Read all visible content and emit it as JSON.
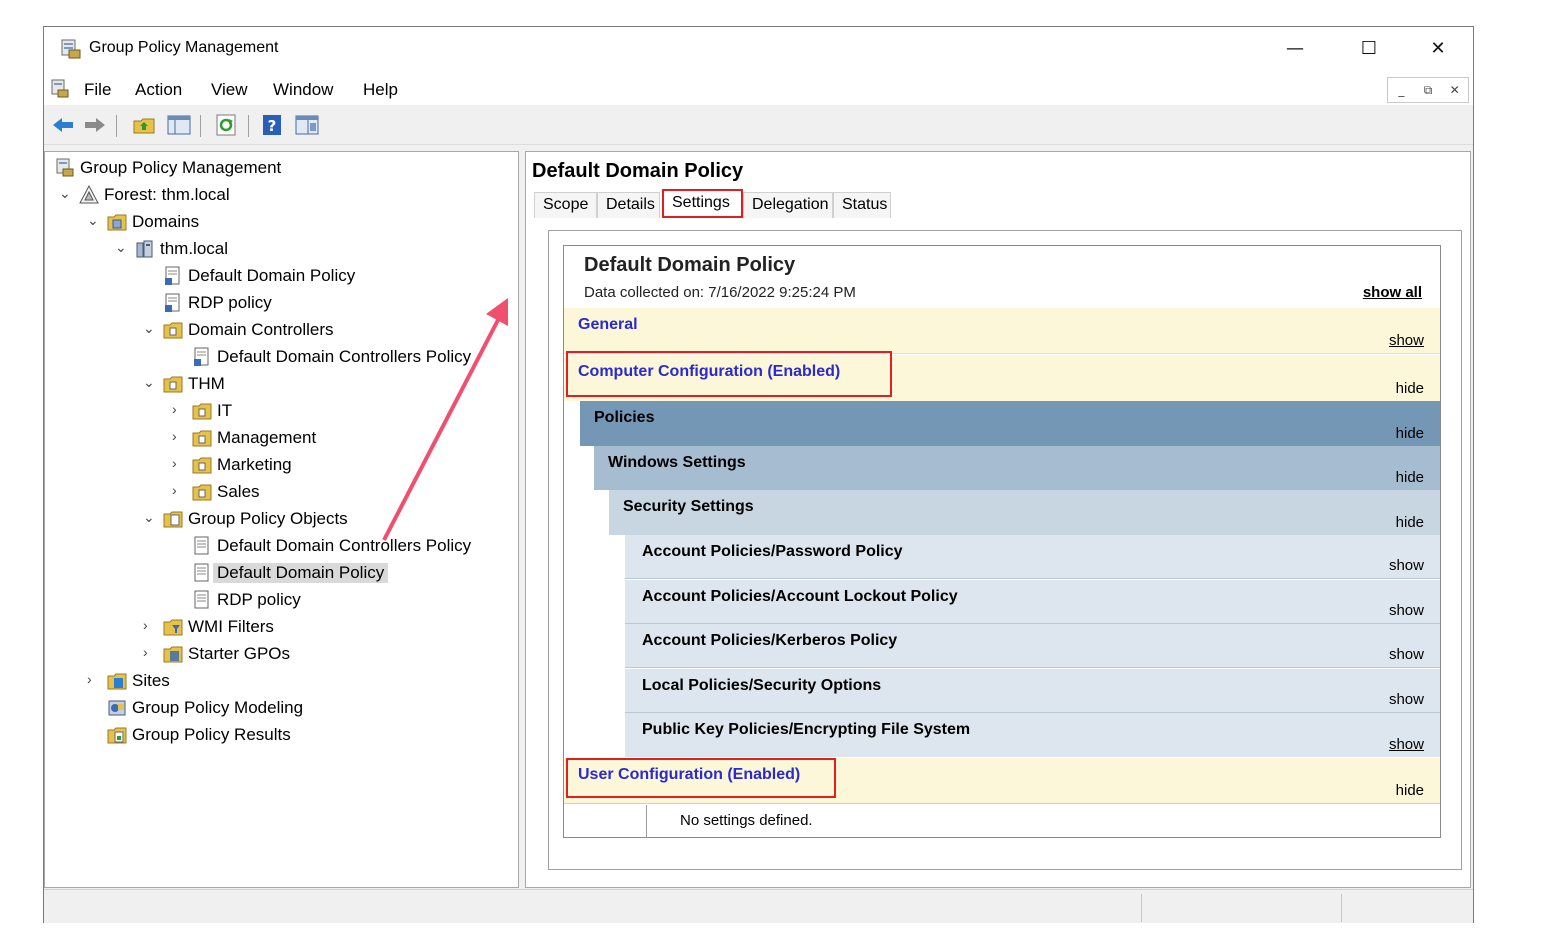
{
  "window": {
    "title": "Group Policy Management",
    "controls": {
      "minimize": "—",
      "maximize": "☐",
      "close": "✕"
    }
  },
  "menu": {
    "items": [
      "File",
      "Action",
      "View",
      "Window",
      "Help"
    ],
    "mdi": {
      "minimize": "_",
      "restore": "⧉",
      "close": "✕"
    }
  },
  "toolbar": {
    "buttons": [
      "back-icon",
      "forward-icon",
      "up-folder-icon",
      "show-hide-tree-icon",
      "refresh-icon",
      "help-icon",
      "properties-icon"
    ]
  },
  "tree": {
    "items": [
      {
        "label": "Group Policy Management",
        "icon": "gpm-icon",
        "arrow": ""
      },
      {
        "label": "Forest: thm.local",
        "icon": "forest-icon",
        "arrow": "⌄"
      },
      {
        "label": "Domains",
        "icon": "domains-icon",
        "arrow": "⌄"
      },
      {
        "label": "thm.local",
        "icon": "domain-icon",
        "arrow": "⌄"
      },
      {
        "label": "Default Domain Policy",
        "icon": "gpo-link-icon",
        "arrow": ""
      },
      {
        "label": "RDP policy",
        "icon": "gpo-link-icon",
        "arrow": ""
      },
      {
        "label": "Domain Controllers",
        "icon": "ou-icon",
        "arrow": "⌄"
      },
      {
        "label": "Default Domain Controllers Policy",
        "icon": "gpo-link-icon",
        "arrow": ""
      },
      {
        "label": "THM",
        "icon": "ou-icon",
        "arrow": "⌄"
      },
      {
        "label": "IT",
        "icon": "ou-icon",
        "arrow": "›"
      },
      {
        "label": "Management",
        "icon": "ou-icon",
        "arrow": "›"
      },
      {
        "label": "Marketing",
        "icon": "ou-icon",
        "arrow": "›"
      },
      {
        "label": "Sales",
        "icon": "ou-icon",
        "arrow": "›"
      },
      {
        "label": "Group Policy Objects",
        "icon": "gpo-folder-icon",
        "arrow": "⌄"
      },
      {
        "label": "Default Domain Controllers Policy",
        "icon": "gpo-icon",
        "arrow": ""
      },
      {
        "label": "Default Domain Policy",
        "icon": "gpo-icon",
        "arrow": ""
      },
      {
        "label": "RDP policy",
        "icon": "gpo-icon",
        "arrow": ""
      },
      {
        "label": "WMI Filters",
        "icon": "wmi-folder-icon",
        "arrow": "›"
      },
      {
        "label": "Starter GPOs",
        "icon": "starter-folder-icon",
        "arrow": "›"
      },
      {
        "label": "Sites",
        "icon": "sites-icon",
        "arrow": "›"
      },
      {
        "label": "Group Policy Modeling",
        "icon": "modeling-icon",
        "arrow": ""
      },
      {
        "label": "Group Policy Results",
        "icon": "results-icon",
        "arrow": ""
      }
    ]
  },
  "detail": {
    "title": "Default Domain Policy",
    "tabs": [
      "Scope",
      "Details",
      "Settings",
      "Delegation",
      "Status"
    ],
    "active_tab": "Settings",
    "report": {
      "title": "Default Domain Policy",
      "collected": "Data collected on: 7/16/2022 9:25:24 PM",
      "show_all": "show all",
      "sections": [
        {
          "label": "General",
          "action": "show"
        },
        {
          "label": "Computer Configuration (Enabled)",
          "action": "hide"
        },
        {
          "label": "Policies",
          "action": "hide"
        },
        {
          "label": "Windows Settings",
          "action": "hide"
        },
        {
          "label": "Security Settings",
          "action": "hide"
        },
        {
          "label": "Account Policies/Password Policy",
          "action": "show"
        },
        {
          "label": "Account Policies/Account Lockout Policy",
          "action": "show"
        },
        {
          "label": "Account Policies/Kerberos Policy",
          "action": "show"
        },
        {
          "label": "Local Policies/Security Options",
          "action": "show"
        },
        {
          "label": "Public Key Policies/Encrypting File System",
          "action": "show"
        },
        {
          "label": "User Configuration (Enabled)",
          "action": "hide"
        }
      ],
      "no_settings": "No settings defined."
    }
  },
  "colors": {
    "highlight_box": "#e02020",
    "arrow": "#f0506e",
    "band_yellow": "#fbf7d8",
    "band_policies": "#7397b5",
    "band_windows": "#a6bcd0",
    "band_security": "#c8d6e2",
    "band_item": "#dde6ee",
    "link_blue": "#2a2acf"
  }
}
